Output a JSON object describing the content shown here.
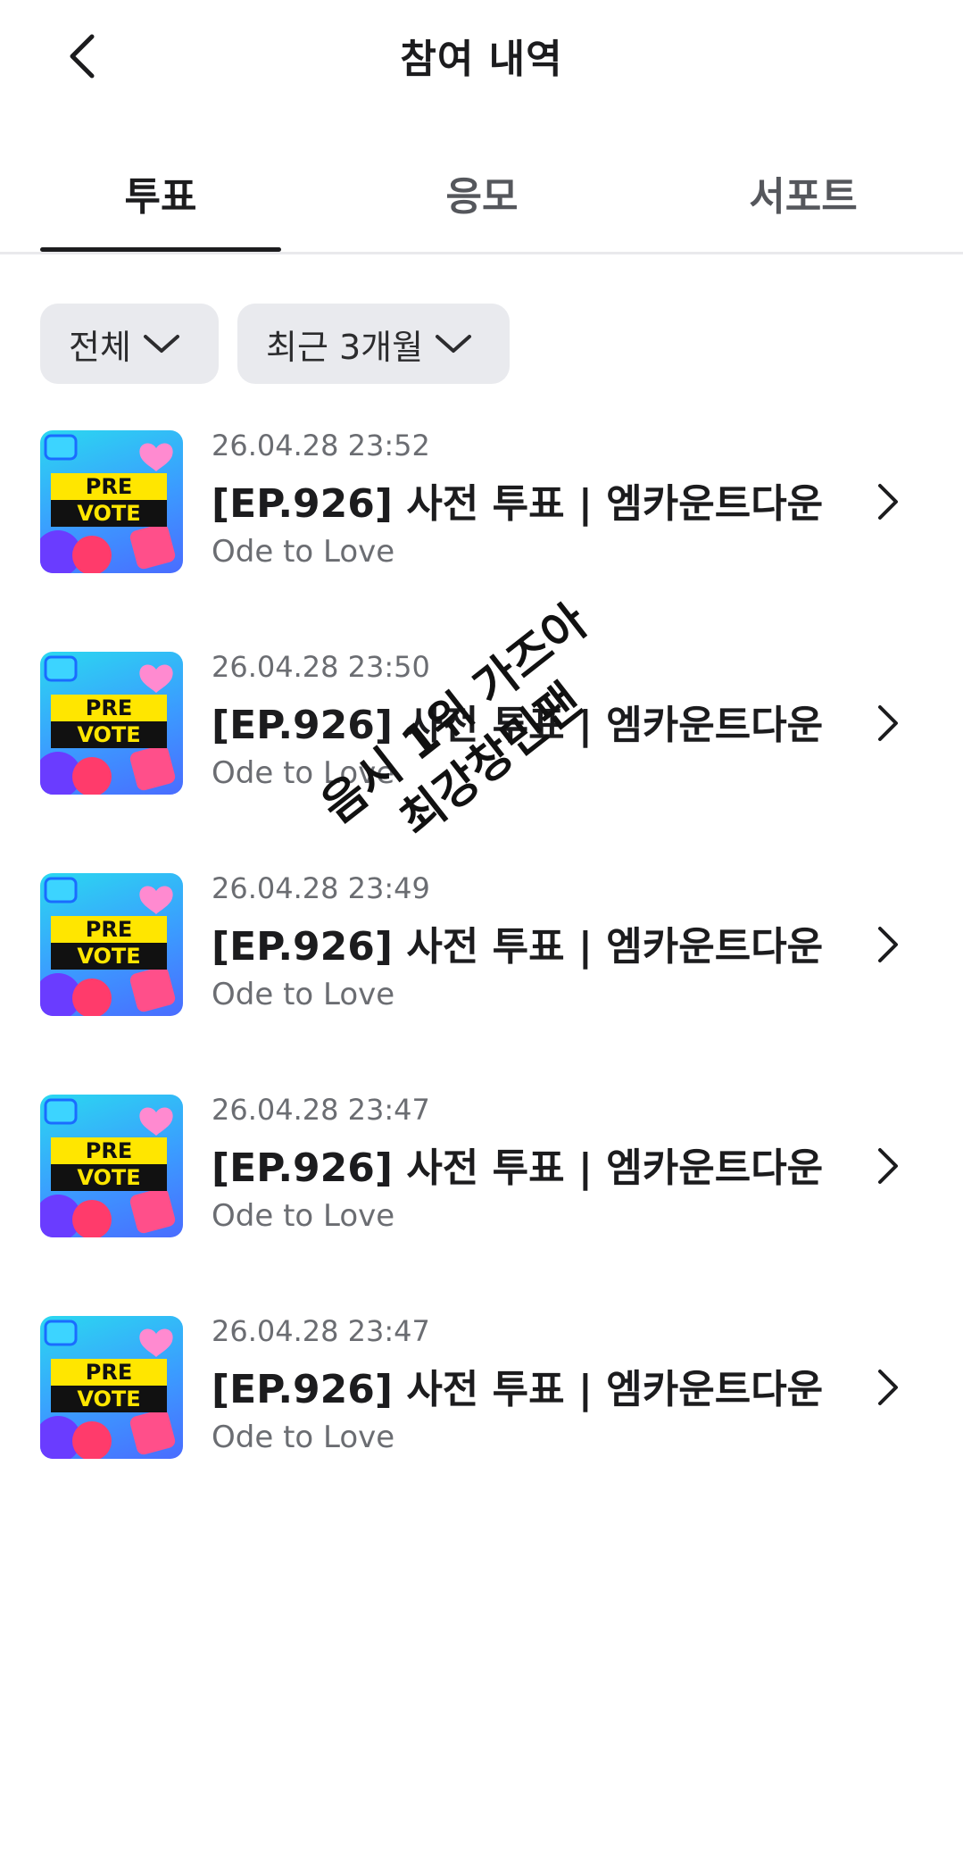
{
  "header": {
    "title": "참여 내역"
  },
  "tabs": [
    {
      "label": "투표",
      "active": true
    },
    {
      "label": "응모",
      "active": false
    },
    {
      "label": "서포트",
      "active": false
    }
  ],
  "filters": {
    "category": "전체",
    "period": "최근 3개월"
  },
  "items": [
    {
      "datetime": "26.04.28 23:52",
      "title": "[EP.926] 사전 투표 | 엠카운트다운",
      "subtitle": "Ode to Love",
      "thumb_label_top": "PRE",
      "thumb_label_bottom": "VOTE"
    },
    {
      "datetime": "26.04.28 23:50",
      "title": "[EP.926] 사전 투표 | 엠카운트다운",
      "subtitle": "Ode to Love",
      "thumb_label_top": "PRE",
      "thumb_label_bottom": "VOTE"
    },
    {
      "datetime": "26.04.28 23:49",
      "title": "[EP.926] 사전 투표 | 엠카운트다운",
      "subtitle": "Ode to Love",
      "thumb_label_top": "PRE",
      "thumb_label_bottom": "VOTE"
    },
    {
      "datetime": "26.04.28 23:47",
      "title": "[EP.926] 사전 투표 | 엠카운트다운",
      "subtitle": "Ode to Love",
      "thumb_label_top": "PRE",
      "thumb_label_bottom": "VOTE"
    },
    {
      "datetime": "26.04.28 23:47",
      "title": "[EP.926] 사전 투표 | 엠카운트다운",
      "subtitle": "Ode to Love",
      "thumb_label_top": "PRE",
      "thumb_label_bottom": "VOTE"
    }
  ],
  "watermark": {
    "line1": "음시 1위 가즈아",
    "line2": "최강창민팬"
  },
  "colors": {
    "accent": "#1c1c1e",
    "chip_bg": "#e9eaee",
    "muted_text": "#6b6d72"
  }
}
